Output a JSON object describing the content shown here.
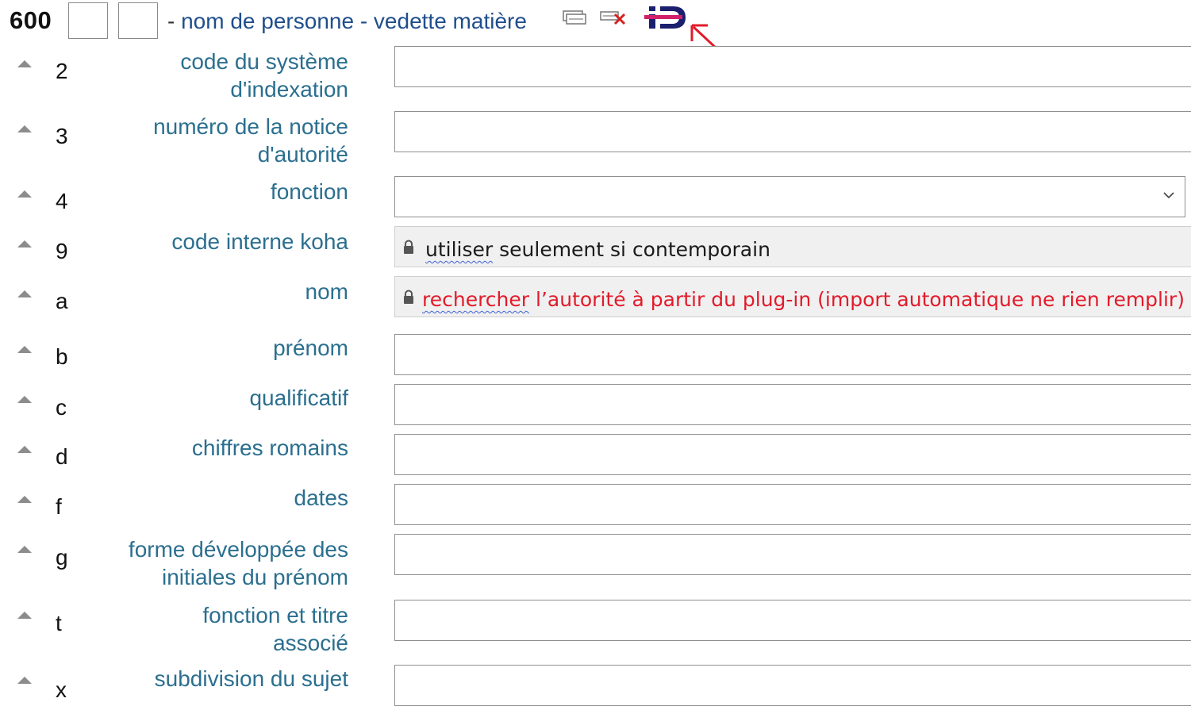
{
  "field": {
    "tag": "600",
    "dash": "-",
    "title": "nom de personne - vedette matière",
    "indicator1": "",
    "indicator2": "",
    "icons": [
      "copy-field-icon",
      "delete-field-icon",
      "idref-plugin-icon",
      "red-arrow-annotation-icon"
    ],
    "annotation_color": "#e21b2a"
  },
  "subfields": [
    {
      "code": "2",
      "label_lines": [
        "code du système",
        "d'indexation"
      ],
      "value": "",
      "type": "text"
    },
    {
      "code": "3",
      "label_lines": [
        "numéro de la notice",
        "d'autorité"
      ],
      "value": "",
      "type": "text"
    },
    {
      "code": "4",
      "label_lines": [
        "fonction"
      ],
      "value": "",
      "type": "select"
    },
    {
      "code": "9",
      "label_lines": [
        "code interne koha"
      ],
      "value_first": "utiliser",
      "value_rest": " seulement si contemporain",
      "type": "locked"
    },
    {
      "code": "a",
      "label_lines": [
        "nom"
      ],
      "value_first": "rechercher",
      "value_rest": " l’autorité à partir du plug-in (import automatique ne rien remplir)",
      "type": "locked"
    },
    {
      "code": "b",
      "label_lines": [
        "prénom"
      ],
      "value": "",
      "type": "text"
    },
    {
      "code": "c",
      "label_lines": [
        "qualificatif"
      ],
      "value": "",
      "type": "text"
    },
    {
      "code": "d",
      "label_lines": [
        "chiffres romains"
      ],
      "value": "",
      "type": "text"
    },
    {
      "code": "f",
      "label_lines": [
        "dates"
      ],
      "value": "",
      "type": "text"
    },
    {
      "code": "g",
      "label_lines": [
        "forme développée des",
        "initiales du prénom"
      ],
      "value": "",
      "type": "text"
    },
    {
      "code": "t",
      "label_lines": [
        "fonction et titre",
        "associé"
      ],
      "value": "",
      "type": "text"
    },
    {
      "code": "x",
      "label_lines": [
        "subdivision du sujet"
      ],
      "value": "",
      "type": "text"
    }
  ],
  "colors": {
    "label": "#2b6f8f",
    "title": "#1f4e8c",
    "locked_bg": "#f0f0f0",
    "red_text": "#e21b2a"
  }
}
